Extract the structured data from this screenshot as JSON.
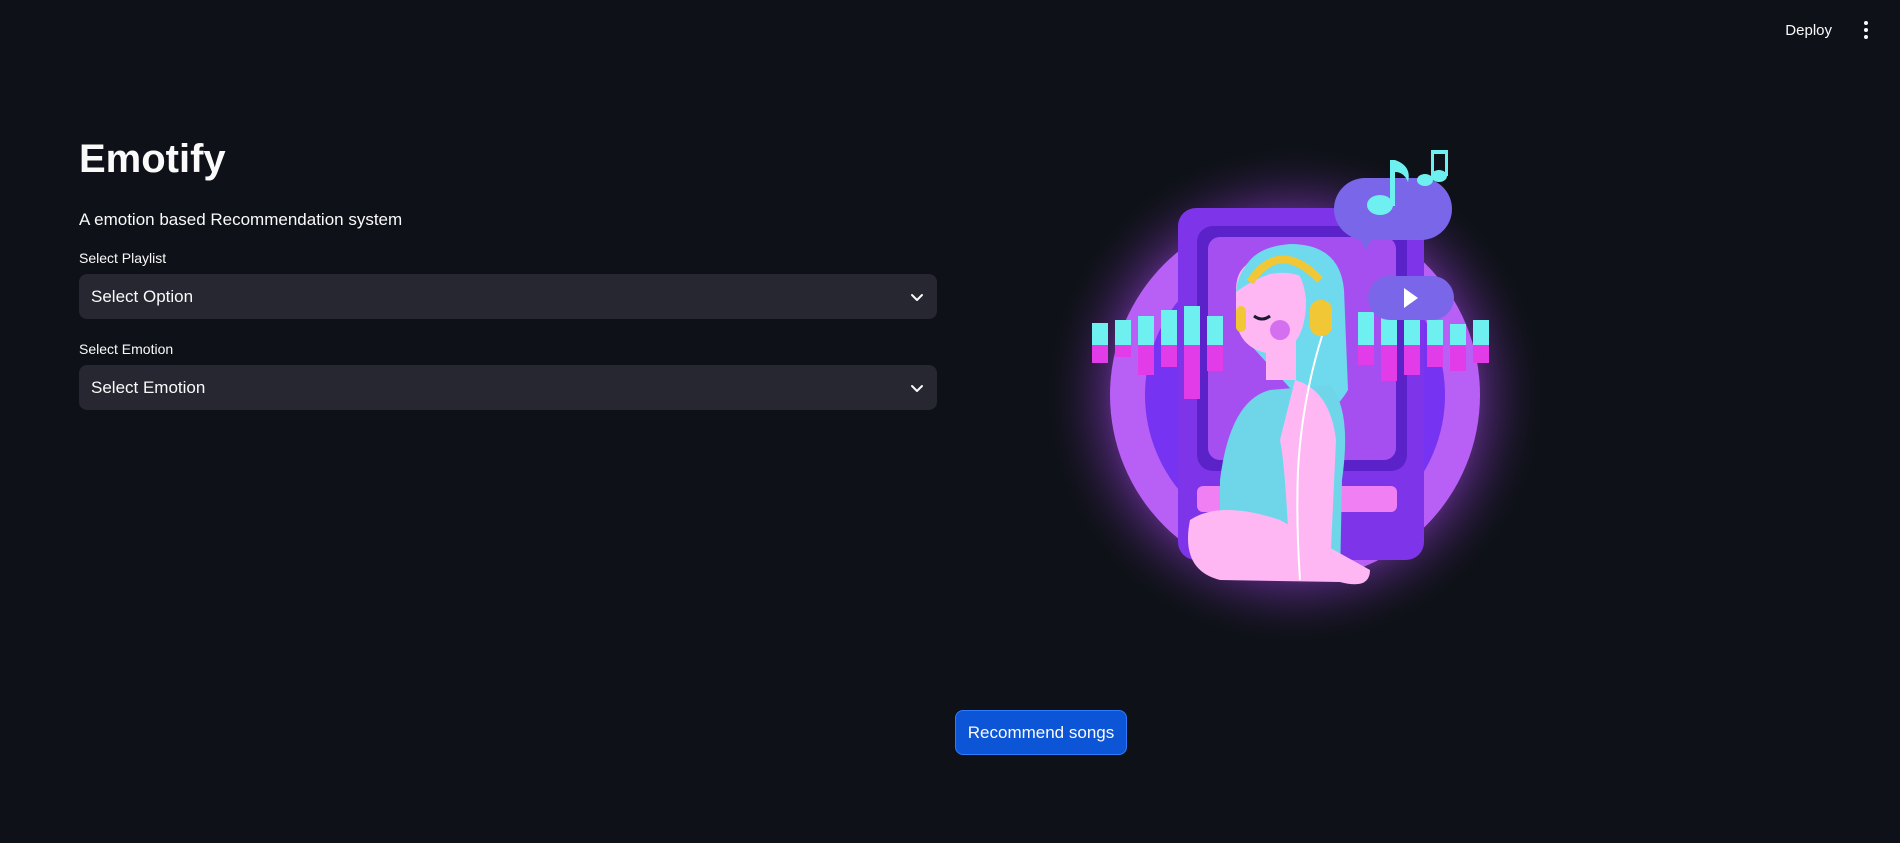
{
  "header": {
    "deploy_label": "Deploy",
    "menu_icon": "kebab-menu-icon"
  },
  "main": {
    "title": "Emotify",
    "subtitle": "A emotion based Recommendation system",
    "playlist": {
      "label": "Select Playlist",
      "value": "Select Option"
    },
    "emotion": {
      "label": "Select Emotion",
      "value": "Select Emotion"
    },
    "recommend_label": "Recommend songs"
  },
  "illustration": {
    "subject": "music-listener-illustration",
    "colors": {
      "glow": "#c46bff",
      "circle": "#b860f5",
      "phone": "#7e34e8",
      "cyan": "#6ff0f0",
      "magenta": "#e23ce8",
      "bubble": "#7a66e8",
      "headphones": "#f2c736"
    }
  },
  "colors": {
    "background": "#0e1117",
    "select_bg": "#262730",
    "button_bg": "#0b55d6",
    "text": "#fafafa"
  }
}
